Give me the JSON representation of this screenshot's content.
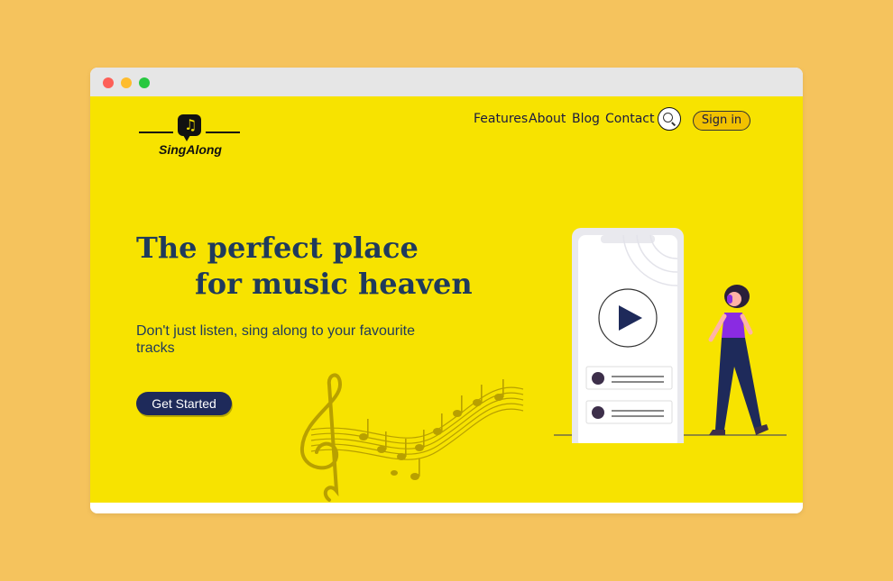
{
  "window": {
    "controls": [
      "close",
      "minimize",
      "maximize"
    ]
  },
  "brand": {
    "name": "SingAlong",
    "logo_icon": "music-note-chat-bubble-icon"
  },
  "nav": {
    "items": [
      "Features",
      "About",
      "Blog",
      "Contact"
    ],
    "search_icon": "search-icon",
    "signin_label": "Sign in"
  },
  "hero": {
    "headline_line1": "The perfect place",
    "headline_line2": "for music heaven",
    "subtitle": "Don't just listen, sing along to your favourite tracks",
    "cta_label": "Get Started"
  },
  "illustration": {
    "phone_icon": "play-icon",
    "figure": "person-with-headphones"
  },
  "colors": {
    "page_bg": "#f5c35d",
    "hero_bg": "#f7e300",
    "navy": "#1e2a5a",
    "heading": "#1f3a5c",
    "accent_purple": "#8a2be2",
    "signin_bg": "#f2c200"
  }
}
